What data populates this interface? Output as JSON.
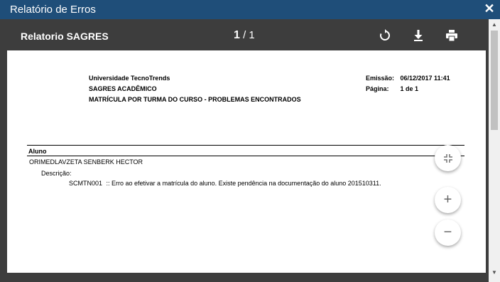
{
  "window": {
    "title": "Relatório de Erros",
    "close_glyph": "✕"
  },
  "toolbar": {
    "doc_title": "Relatorio SAGRES",
    "current_page": "1",
    "separator": "/",
    "total_pages": "1",
    "icons": [
      "rotate-icon",
      "download-icon",
      "print-icon"
    ]
  },
  "report": {
    "institution": "Universidade TecnoTrends",
    "system": "SAGRES ACADÊMICO",
    "subtitle": "MATRÍCULA POR TURMA DO CURSO - PROBLEMAS ENCONTRADOS",
    "emission_label": "Emissão:",
    "emission_value": "06/12/2017 11:41",
    "page_label": "Página:",
    "page_value": "1 de 1",
    "column_header": "Aluno",
    "student_name": "ORIMEDLAVZETA SENBERK HECTOR",
    "description_label": "Descrição:",
    "error_code": "SCMTN001",
    "error_text": ":: Erro ao efetivar a matrícula do aluno. Existe pendência na documentação do aluno 201510311."
  },
  "zoom": {
    "fit_icon": "fit-page-icon",
    "in_label": "+",
    "out_label": "−"
  },
  "colors": {
    "titlebar": "#1f4e79",
    "viewer_bg": "#3d3d3d",
    "page": "#ffffff"
  }
}
